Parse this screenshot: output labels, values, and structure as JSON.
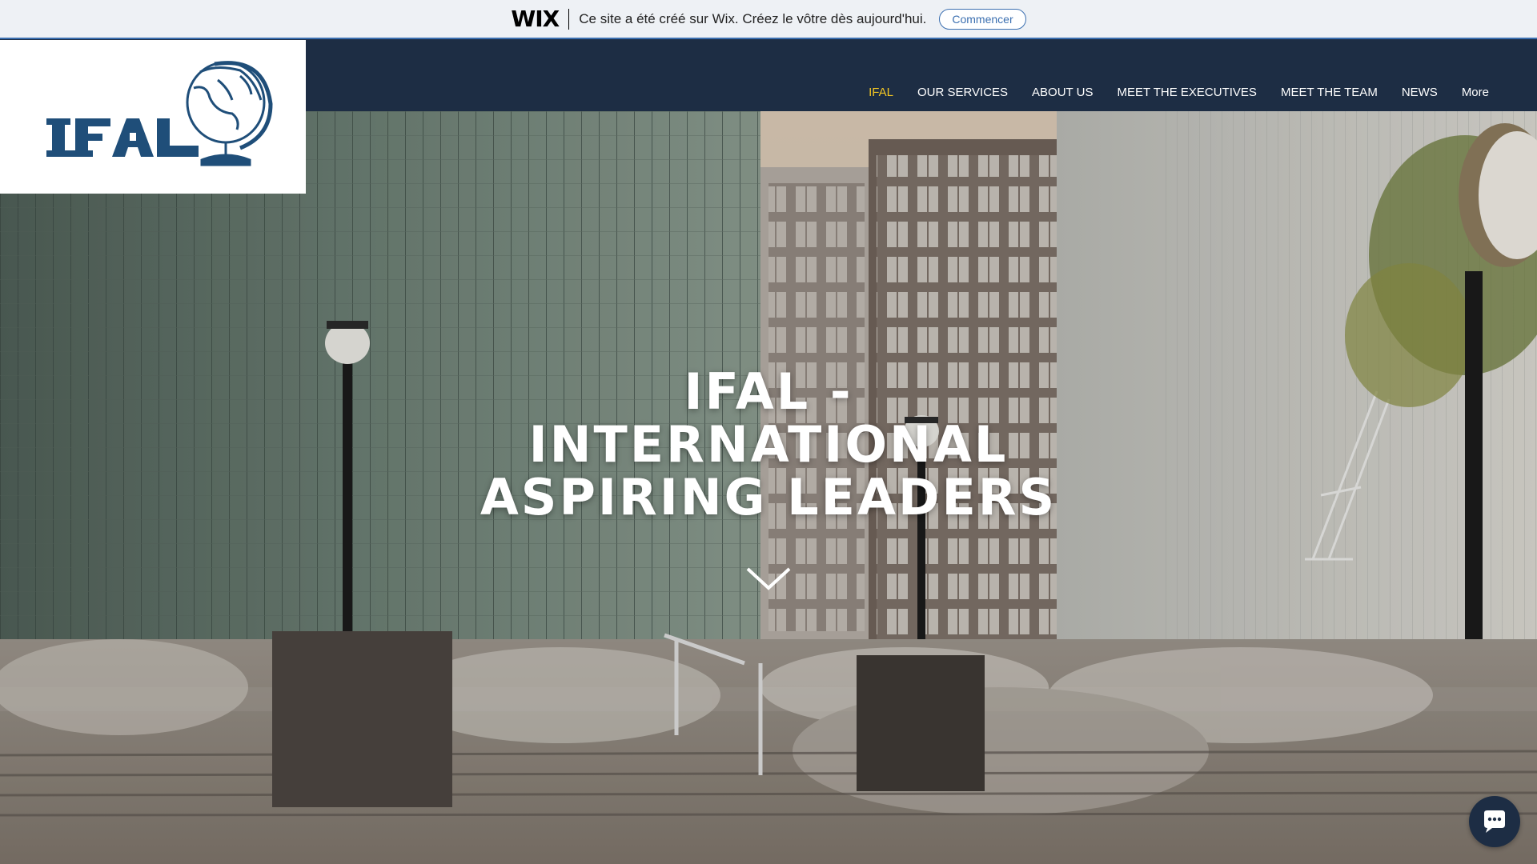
{
  "wix_banner": {
    "logo": "WIX",
    "message": "Ce site a été créé sur Wix. Créez le vôtre dès aujourd'hui.",
    "cta": "Commencer"
  },
  "logo": {
    "text": "IFAL",
    "icon": "globe-icon"
  },
  "nav": {
    "items": [
      {
        "label": "IFAL",
        "active": true
      },
      {
        "label": "OUR SERVICES"
      },
      {
        "label": "ABOUT US"
      },
      {
        "label": "MEET THE EXECUTIVES"
      },
      {
        "label": "MEET THE TEAM"
      },
      {
        "label": "NEWS"
      },
      {
        "label": "More"
      }
    ]
  },
  "hero": {
    "title_line1": "IFAL -",
    "title_line2": "INTERNATIONAL",
    "title_line3": "ASPIRING LEADERS",
    "arrow_icon": "chevron-down-icon"
  },
  "chat": {
    "icon": "chat-bubble-icon"
  },
  "colors": {
    "header_bg": "#1d2d44",
    "nav_active": "#f3c623",
    "logo_blue": "#1f4e79",
    "wix_accent": "#3b6fb0"
  }
}
